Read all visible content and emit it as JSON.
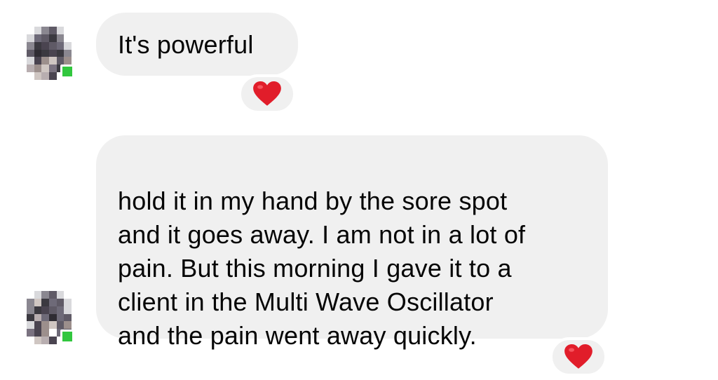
{
  "thread": {
    "messages": [
      {
        "sender": "other",
        "text": "It's powerful",
        "reaction": {
          "icon": "red-heart-icon"
        }
      },
      {
        "sender": "other",
        "text": "hold it in my hand by the sore spot\nand it goes away. I am not in a lot of\npain. But this morning I gave it to a\nclient in the Multi Wave Oscillator\nand the pain went away quickly.",
        "reaction": {
          "icon": "red-heart-icon"
        }
      }
    ]
  },
  "colors": {
    "bubble_background": "#f0f0f0",
    "text": "#050505",
    "heart": "#e11d2a",
    "online_indicator": "#31c73e"
  }
}
